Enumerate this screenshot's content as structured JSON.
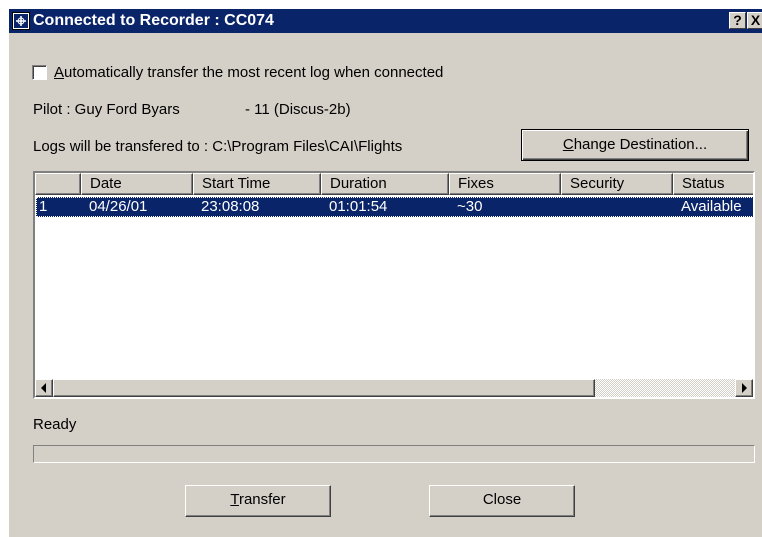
{
  "window": {
    "title": "Connected to Recorder : CC074",
    "help_label": "?",
    "close_label": "X"
  },
  "auto_transfer": {
    "label": "Automatically transfer the most recent log when connected",
    "checked": false
  },
  "pilot": {
    "label": "Pilot : Guy Ford Byars",
    "glider": "- 11  (Discus-2b)"
  },
  "destination": {
    "label": "Logs will be transfered to : C:\\Program Files\\CAI\\Flights",
    "change_button": "Change Destination..."
  },
  "logs_table": {
    "columns": [
      "",
      "Date",
      "Start Time",
      "Duration",
      "Fixes",
      "Security",
      "Status"
    ],
    "rows": [
      [
        "1",
        "04/26/01",
        "23:08:08",
        "01:01:54",
        "~30",
        "",
        "Available"
      ]
    ],
    "selected_row": 0
  },
  "status": {
    "text": "Ready",
    "progress": 0
  },
  "buttons": {
    "transfer": "Transfer",
    "close": "Close"
  },
  "colors": {
    "titlebar": "#0a246a",
    "face": "#d4d0c8",
    "selection": "#0a246a"
  }
}
